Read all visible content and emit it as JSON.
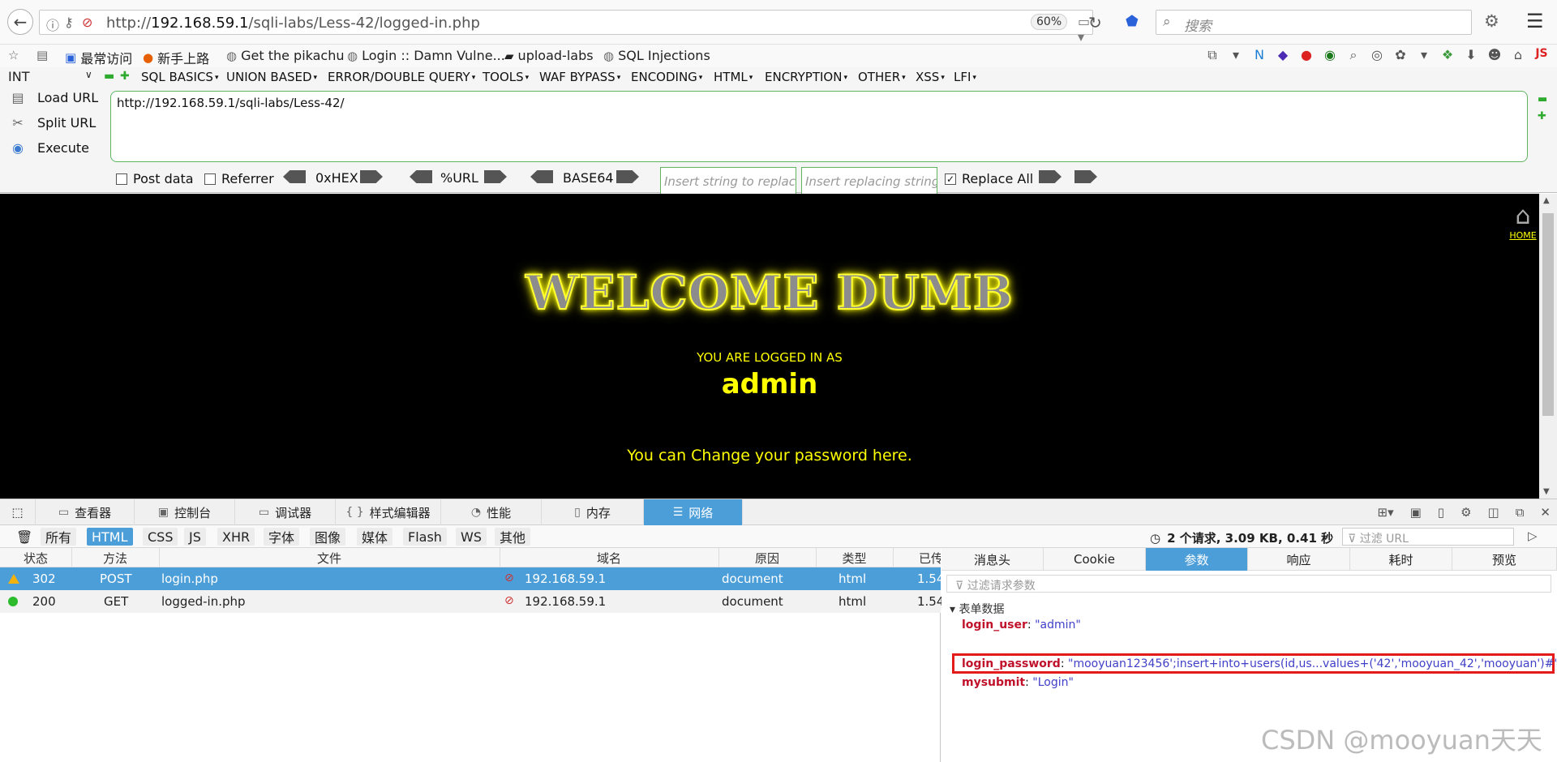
{
  "browser": {
    "url_prefix": "http://",
    "url_host": "192.168.59.1",
    "url_path": "/sqli-labs/Less-42/logged-in.php",
    "zoom": "60%",
    "search_placeholder": "搜索"
  },
  "bookmarks": [
    {
      "label": "最常访问",
      "icon": "page-icon"
    },
    {
      "label": "新手上路",
      "icon": "firefox-icon"
    },
    {
      "label": "Get the pikachu",
      "icon": "globe-icon"
    },
    {
      "label": "Login :: Damn Vulne...",
      "icon": "globe-icon"
    },
    {
      "label": "upload-labs",
      "icon": "folder-icon"
    },
    {
      "label": "SQL Injections",
      "icon": "globe-icon"
    }
  ],
  "hackbar": {
    "type_select": "INT",
    "menus": [
      "SQL BASICS",
      "UNION BASED",
      "ERROR/DOUBLE QUERY",
      "TOOLS",
      "WAF BYPASS",
      "ENCODING",
      "HTML",
      "ENCRYPTION",
      "OTHER",
      "XSS",
      "LFI"
    ],
    "load_url": "Load URL",
    "split_url": "Split URL",
    "execute": "Execute",
    "url_value": "http://192.168.59.1/sqli-labs/Less-42/",
    "post_data": "Post data",
    "referrer": "Referrer",
    "hex": "0xHEX",
    "urlenc": "%URL",
    "base64": "BASE64",
    "insert_placeholder": "Insert string to replace",
    "replacing_placeholder": "Insert replacing string",
    "replace_all": "Replace All"
  },
  "page": {
    "home": "HOME",
    "welcome": "WELCOME DUMB",
    "logged_label": "YOU ARE LOGGED IN AS",
    "user": "admin",
    "change_pw": "You can Change your password here."
  },
  "devtools": {
    "tabs": [
      "查看器",
      "控制台",
      "调试器",
      "样式编辑器",
      "性能",
      "内存",
      "网络"
    ],
    "filters": [
      "所有",
      "HTML",
      "CSS",
      "JS",
      "XHR",
      "字体",
      "图像",
      "媒体",
      "Flash",
      "WS",
      "其他"
    ],
    "summary": "2 个请求, 3.09 KB, 0.41 秒",
    "url_filter_placeholder": "过滤 URL",
    "columns": [
      "状态",
      "方法",
      "文件",
      "域名",
      "原因",
      "类型",
      "已传"
    ],
    "requests": [
      {
        "status": "302",
        "method": "POST",
        "file": "login.php",
        "domain": "192.168.59.1",
        "cause": "document",
        "type": "html",
        "size": "1.54"
      },
      {
        "status": "200",
        "method": "GET",
        "file": "logged-in.php",
        "domain": "192.168.59.1",
        "cause": "document",
        "type": "html",
        "size": "1.54"
      }
    ],
    "detail_tabs": [
      "消息头",
      "Cookie",
      "参数",
      "响应",
      "耗时",
      "预览"
    ],
    "param_filter_placeholder": "过滤请求参数",
    "form_section": "表单数据",
    "params": [
      {
        "key": "login_user",
        "value": "\"admin\""
      },
      {
        "key": "login_password",
        "value": "\"mooyuan123456';insert+into+users(id,us...values+('42','mooyuan_42','mooyuan')#\""
      },
      {
        "key": "mysubmit",
        "value": "\"Login\""
      }
    ]
  },
  "watermark": "CSDN @mooyuan天天",
  "colors": {
    "accent": "#4c9ed9",
    "page_bg": "#000000",
    "page_text": "#ffff00",
    "highlight": "#e41b1b"
  }
}
